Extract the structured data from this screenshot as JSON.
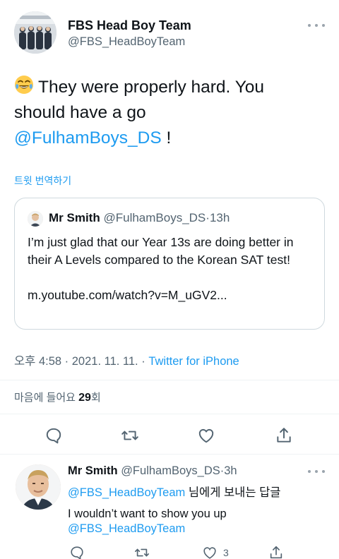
{
  "tweet": {
    "author_name": "FBS Head Boy Team",
    "author_handle": "@FBS_HeadBoyTeam",
    "text_main": "They were properly hard. You should have a go",
    "mention": "@FulhamBoys_DS",
    "text_end": " !",
    "emoji": "joy-emoji",
    "translate_label": "트윗 번역하기",
    "time": "오후 4:58",
    "date": "2021. 11. 11.",
    "separator": "·",
    "source": "Twitter for iPhone",
    "likes_prefix": "마음에 들어요",
    "likes_count": "29",
    "likes_suffix": "회"
  },
  "quote": {
    "author_name": "Mr Smith",
    "author_handle": "@FulhamBoys_DS",
    "separator": "·",
    "age": "13h",
    "text": "I’m just glad that our Year 13s are doing better in their A Levels compared to the Korean SAT test!",
    "link": "m.youtube.com/watch?v=M_uGV2..."
  },
  "actions": {
    "icons": [
      "reply-icon",
      "retweet-icon",
      "like-icon",
      "share-icon"
    ]
  },
  "reply": {
    "author_name": "Mr Smith",
    "author_handle": "@FulhamBoys_DS",
    "separator": "·",
    "age": "3h",
    "reply_to_handle": "@FBS_HeadBoyTeam",
    "reply_to_suffix": " 님에게 보내는 답글",
    "text": "I wouldn’t want to show you up",
    "mention": "@FBS_HeadBoyTeam",
    "like_count": "3"
  },
  "colors": {
    "accent": "#1d9bf0",
    "text": "#0f1419",
    "secondary": "#536471",
    "border": "#cfd9de"
  }
}
